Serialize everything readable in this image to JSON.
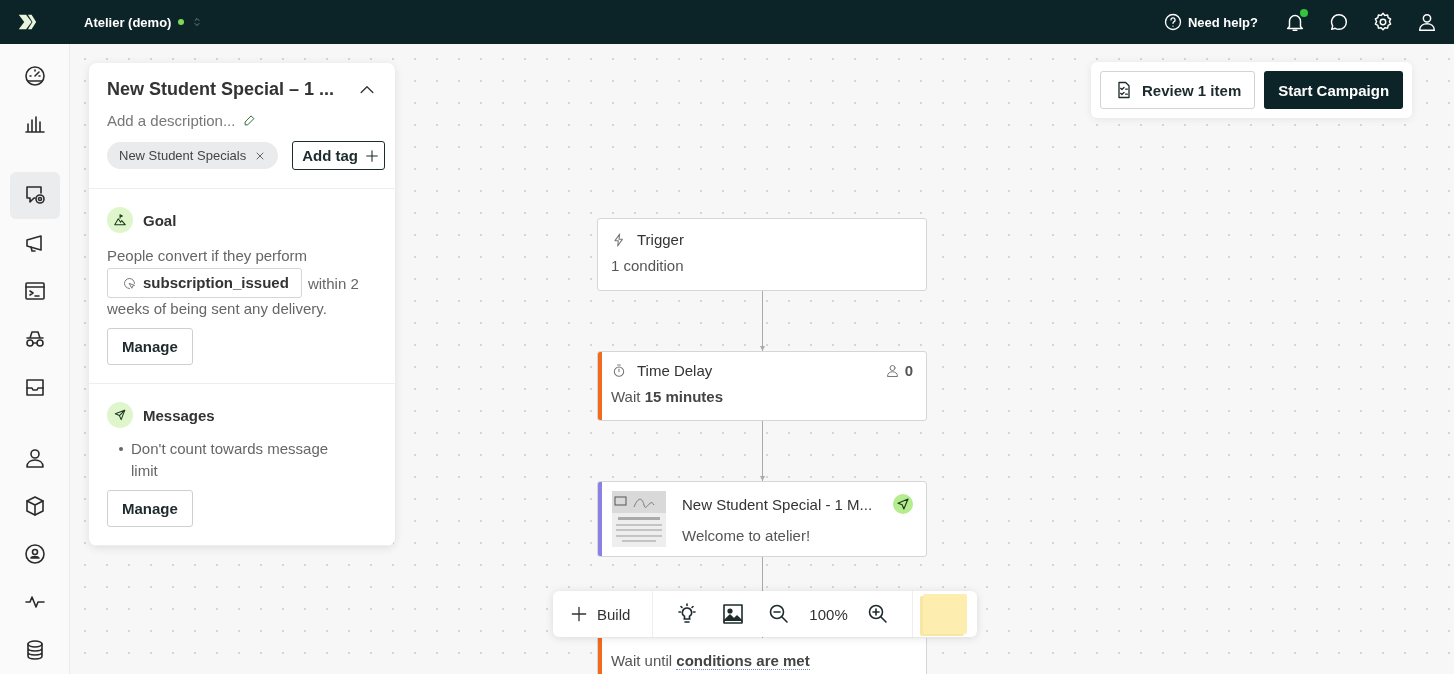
{
  "topbar": {
    "workspace": "Atelier (demo)",
    "online": true,
    "help": "Need help?",
    "notifications_unread": true
  },
  "sidebar": {
    "items": [
      {
        "selected": false
      },
      {
        "selected": false
      },
      {
        "selected": true
      },
      {
        "selected": false
      },
      {
        "selected": false
      },
      {
        "selected": false
      },
      {
        "selected": false
      },
      {
        "selected": false
      },
      {
        "selected": false
      },
      {
        "selected": false
      },
      {
        "selected": false
      },
      {
        "selected": false
      }
    ]
  },
  "panel": {
    "title": "New Student Special – 1 ...",
    "description_placeholder": "Add a description...",
    "tags": [
      {
        "label": "New Student Specials"
      }
    ],
    "add_tag": "Add tag",
    "goal": {
      "title": "Goal",
      "text_before": "People convert if they perform",
      "event": "subscription_issued",
      "text_after": "within 2",
      "text_end": "weeks of being sent any delivery.",
      "button": "Manage"
    },
    "messages": {
      "title": "Messages",
      "bullets": [
        "Don't count towards message limit"
      ],
      "button": "Manage"
    }
  },
  "actions": {
    "review": "Review 1 item",
    "start": "Start Campaign"
  },
  "nodes": [
    {
      "kind": "trigger",
      "title": "Trigger",
      "detail": "1 condition"
    },
    {
      "kind": "delay",
      "title": "Time Delay",
      "detail": "Wait **15 minutes**",
      "count": "0",
      "color": "#f26b1d"
    },
    {
      "kind": "message",
      "title": "New Student Special - 1 M...",
      "detail": "Welcome to atelier!",
      "color": "#8b80e3"
    },
    {
      "kind": "wait",
      "detail": "Wait until **conditions are met**",
      "color": "#f26b1d"
    }
  ],
  "toolbar": {
    "build": "Build",
    "zoom": "100%"
  }
}
